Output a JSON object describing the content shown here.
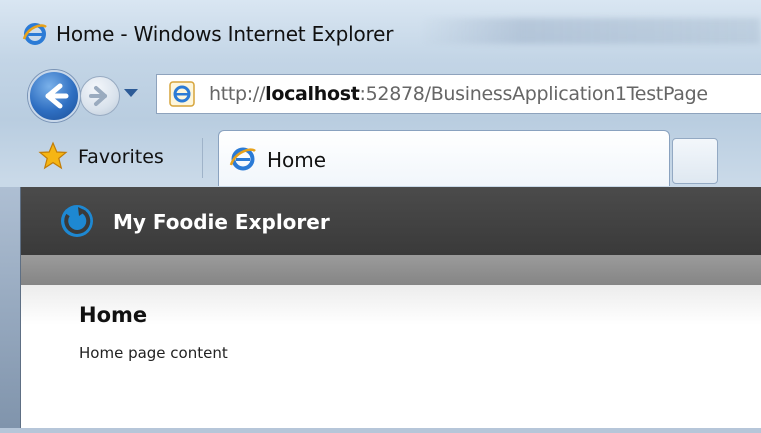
{
  "window": {
    "title": "Home - Windows Internet Explorer"
  },
  "navigation": {
    "address_host_prefix": "http://",
    "address_host": "localhost",
    "address_rest": ":52878/BusinessApplication1TestPage"
  },
  "toolbar": {
    "favorites_label": "Favorites"
  },
  "tabs": [
    {
      "label": "Home"
    }
  ],
  "app": {
    "title": "My Foodie Explorer",
    "header_color": "#3f3f3f",
    "accent_color": "#1e88d2"
  },
  "content": {
    "heading": "Home",
    "body": "Home page content"
  },
  "icons": {
    "browser": "internet-explorer-icon",
    "back": "back-arrow-icon",
    "forward": "forward-arrow-icon",
    "favorites": "star-icon",
    "app_logo": "circular-arrow-logo-icon"
  }
}
